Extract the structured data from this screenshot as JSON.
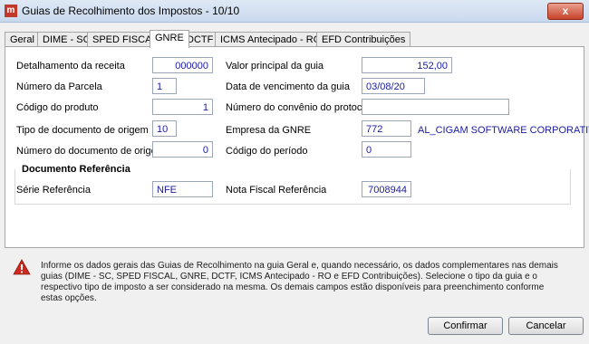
{
  "window": {
    "title": "Guias de Recolhimento dos Impostos - 10/10",
    "close_label": "x"
  },
  "tabs": [
    {
      "label": "Geral"
    },
    {
      "label": "DIME - SC"
    },
    {
      "label": "SPED FISCAL"
    },
    {
      "label": "GNRE"
    },
    {
      "label": "DCTF"
    },
    {
      "label": "ICMS Antecipado - RO"
    },
    {
      "label": "EFD Contribuições"
    }
  ],
  "form": {
    "detalhamento_label": "Detalhamento da receita",
    "detalhamento_value": "000000",
    "parcela_label": "Número da Parcela",
    "parcela_value": "1",
    "produto_label": "Código do produto",
    "produto_value": "1",
    "tipo_doc_label": "Tipo de documento de origem",
    "tipo_doc_value": "10",
    "num_doc_label": "Número do documento de origem",
    "num_doc_value": "0",
    "valor_label": "Valor principal da guia",
    "valor_value": "152,00",
    "vencimento_label": "Data de vencimento da guia",
    "vencimento_value": "03/08/20",
    "convenio_label": "Número do convênio do protocolo",
    "convenio_value": "",
    "empresa_label": "Empresa da GNRE",
    "empresa_value": "772",
    "empresa_name": "AL_CIGAM SOFTWARE CORPORATIVO S",
    "periodo_label": "Código do período",
    "periodo_value": "0"
  },
  "documento_ref": {
    "title": "Documento Referência",
    "serie_label": "Série Referência",
    "serie_value": "NFE",
    "nota_label": "Nota Fiscal Referência",
    "nota_value": "7008944"
  },
  "info": {
    "text": "Informe os dados gerais das Guias de Recolhimento na guia Geral e, quando necessário, os dados complementares nas demais guias (DIME - SC, SPED FISCAL, GNRE, DCTF, ICMS Antecipado - RO e EFD Contribuições). Selecione o tipo da guia e o respectivo tipo de imposto a ser considerado na mesma. Os demais campos estão disponíveis para preenchimento conforme estas opções."
  },
  "buttons": {
    "confirm": "Confirmar",
    "cancel": "Cancelar"
  },
  "colors": {
    "value_text": "#1a1aa6",
    "warning": "#cc2a1e"
  }
}
